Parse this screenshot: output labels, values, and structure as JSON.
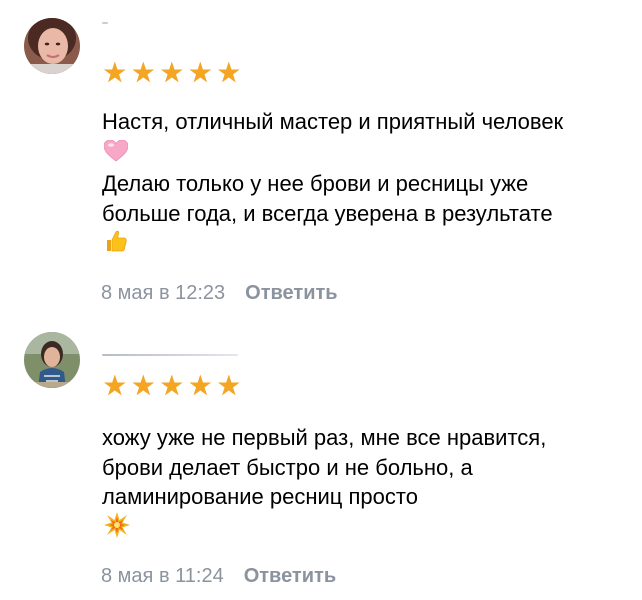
{
  "reviews": [
    {
      "rating": 5,
      "stars": [
        "★",
        "★",
        "★",
        "★",
        "★"
      ],
      "text": "Настя, отличный мастер и приятный человек",
      "emoji_1": "heart-emoji",
      "text_2": "Делаю только у нее брови и ресницы уже больше года, и всегда уверена в результате",
      "emoji_2": "thumbs-up-emoji",
      "timestamp": "8 мая в 12:23",
      "reply_label": "Ответить"
    },
    {
      "rating": 5,
      "stars": [
        "★",
        "★",
        "★",
        "★",
        "★"
      ],
      "text": "хожу уже не первый раз, мне все нравится, брови делает быстро и не больно, а ламинирование ресниц просто",
      "emoji_1": "collision-emoji",
      "timestamp": "8 мая в 11:24",
      "reply_label": "Ответить"
    }
  ],
  "colors": {
    "star": "#f5a524",
    "meta_text": "#8b939e",
    "text": "#000000"
  }
}
